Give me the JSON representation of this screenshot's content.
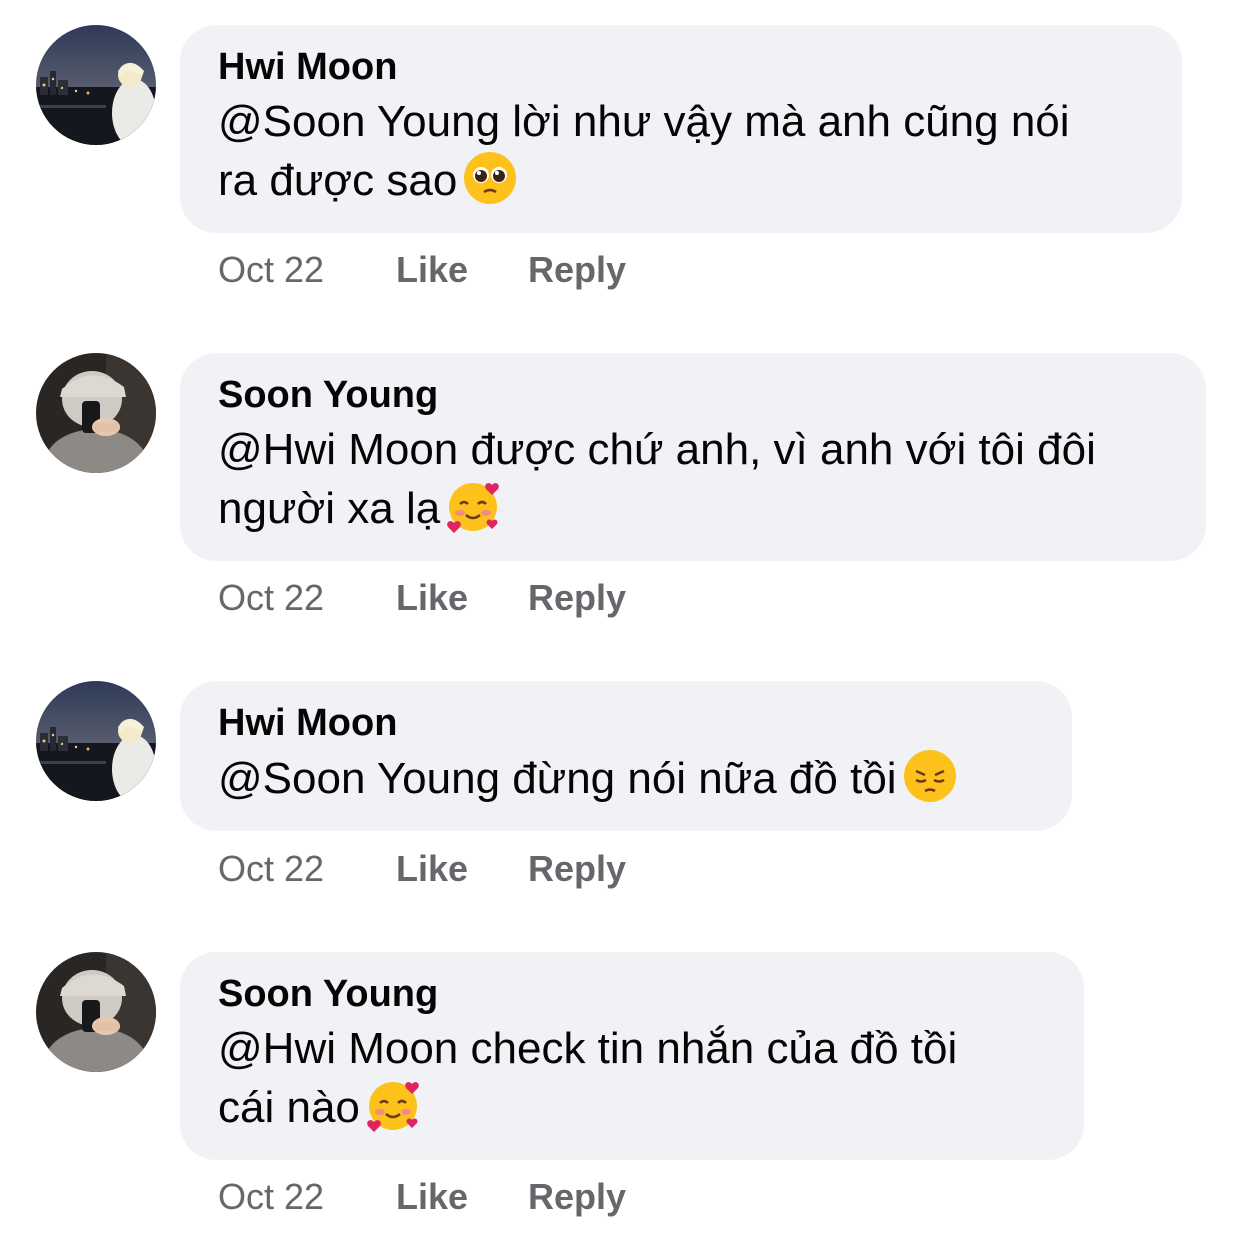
{
  "comments": [
    {
      "author": "Hwi Moon",
      "avatar_icon": "city-night-avatar-icon",
      "text": "@Soon Young lời như vậy mà anh cũng nói\nra được sao",
      "emoji": "pleading-face-emoji",
      "time": "Oct 22",
      "like_label": "Like",
      "reply_label": "Reply"
    },
    {
      "author": "Soon Young",
      "avatar_icon": "mirror-selfie-avatar-icon",
      "text": "@Hwi Moon được chứ anh, vì anh với tôi đôi\nngười xa lạ",
      "emoji": "smiling-face-with-hearts-emoji",
      "time": "Oct 22",
      "like_label": "Like",
      "reply_label": "Reply"
    },
    {
      "author": "Hwi Moon",
      "avatar_icon": "city-night-avatar-icon",
      "text": "@Soon Young đừng nói nữa đồ tồi",
      "emoji": "pensive-face-emoji",
      "time": "Oct 22",
      "like_label": "Like",
      "reply_label": "Reply"
    },
    {
      "author": "Soon Young",
      "avatar_icon": "mirror-selfie-avatar-icon",
      "text": "@Hwi Moon check tin nhắn của đồ tồi\ncái nào",
      "emoji": "smiling-face-with-hearts-emoji",
      "time": "Oct 22",
      "like_label": "Like",
      "reply_label": "Reply"
    }
  ],
  "colors": {
    "bubble": "#f0f2f5",
    "text": "#050505",
    "meta": "#65676b"
  }
}
